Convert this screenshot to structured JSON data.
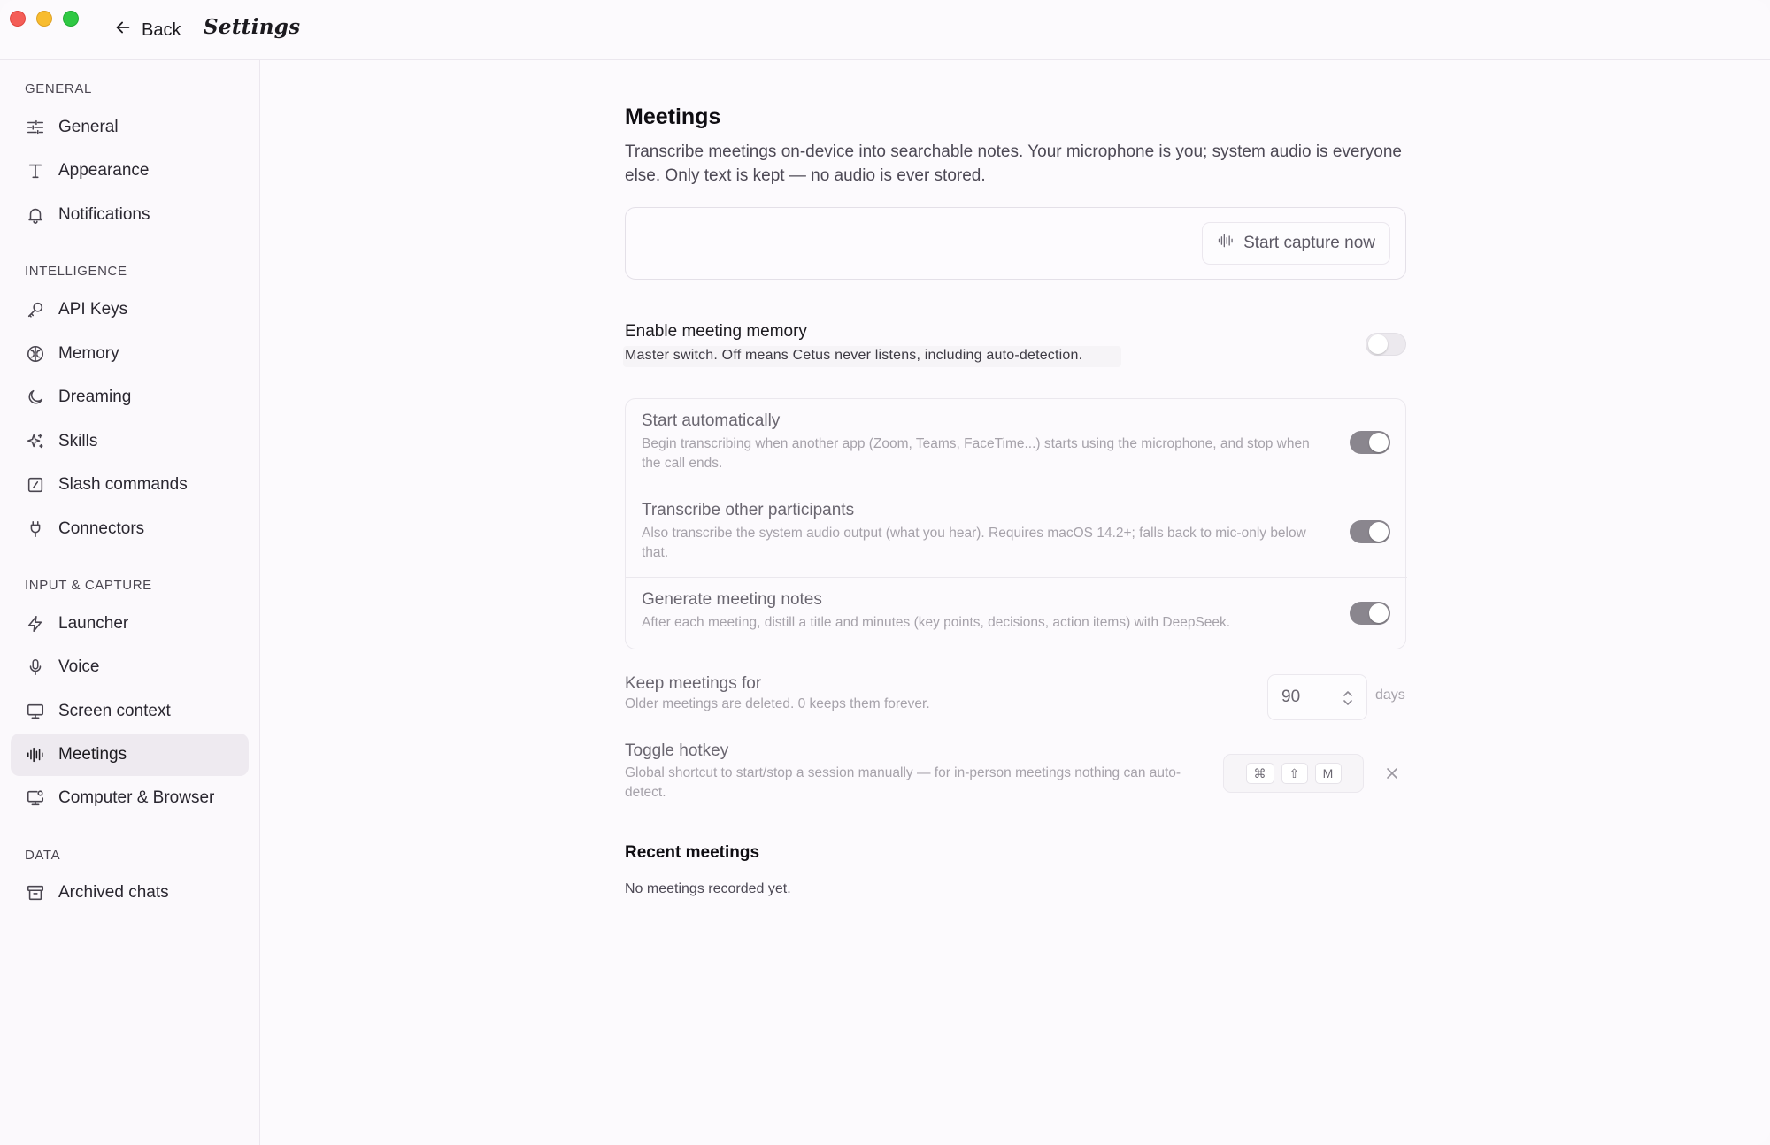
{
  "titlebar": {
    "back_label": "Back",
    "title": "Settings"
  },
  "sidebar": {
    "sections": [
      {
        "label": "GENERAL",
        "items": [
          {
            "label": "General",
            "icon": "sliders-icon"
          },
          {
            "label": "Appearance",
            "icon": "text-type-icon"
          },
          {
            "label": "Notifications",
            "icon": "bell-icon"
          }
        ]
      },
      {
        "label": "INTELLIGENCE",
        "items": [
          {
            "label": "API Keys",
            "icon": "key-icon"
          },
          {
            "label": "Memory",
            "icon": "brain-icon"
          },
          {
            "label": "Dreaming",
            "icon": "moon-icon"
          },
          {
            "label": "Skills",
            "icon": "sparkles-icon"
          },
          {
            "label": "Slash commands",
            "icon": "slash-square-icon"
          },
          {
            "label": "Connectors",
            "icon": "plug-icon"
          }
        ]
      },
      {
        "label": "INPUT & CAPTURE",
        "items": [
          {
            "label": "Launcher",
            "icon": "lightning-icon"
          },
          {
            "label": "Voice",
            "icon": "microphone-icon"
          },
          {
            "label": "Screen context",
            "icon": "monitor-icon"
          },
          {
            "label": "Meetings",
            "icon": "audio-waveform-icon",
            "active": true
          },
          {
            "label": "Computer & Browser",
            "icon": "monitor-cursor-icon"
          }
        ]
      },
      {
        "label": "DATA",
        "items": [
          {
            "label": "Archived chats",
            "icon": "archive-icon"
          }
        ]
      }
    ]
  },
  "main": {
    "title": "Meetings",
    "description": "Transcribe meetings on-device into searchable notes. Your microphone is you; system audio is everyone else. Only text is kept — no audio is ever stored.",
    "capture_button": "Start capture now",
    "master": {
      "title": "Enable meeting memory",
      "subtitle": "Master switch. Off means Cetus never listens, including auto-detection.",
      "enabled": false
    },
    "options": [
      {
        "title": "Start automatically",
        "subtitle": "Begin transcribing when another app (Zoom, Teams, FaceTime...) starts using the microphone, and stop when the call ends.",
        "enabled": true
      },
      {
        "title": "Transcribe other participants",
        "subtitle": "Also transcribe the system audio output (what you hear). Requires macOS 14.2+; falls back to mic-only below that.",
        "enabled": true
      },
      {
        "title": "Generate meeting notes",
        "subtitle": "After each meeting, distill a title and minutes (key points, decisions, action items) with DeepSeek.",
        "enabled": true
      }
    ],
    "retention": {
      "title": "Keep meetings for",
      "subtitle": "Older meetings are deleted. 0 keeps them forever.",
      "value": "90",
      "unit": "days"
    },
    "hotkey": {
      "title": "Toggle hotkey",
      "subtitle": "Global shortcut to start/stop a session manually — for in-person meetings nothing can auto-detect.",
      "keys": [
        "⌘",
        "⇧",
        "M"
      ]
    },
    "recent": {
      "title": "Recent meetings",
      "empty": "No meetings recorded yet."
    }
  }
}
